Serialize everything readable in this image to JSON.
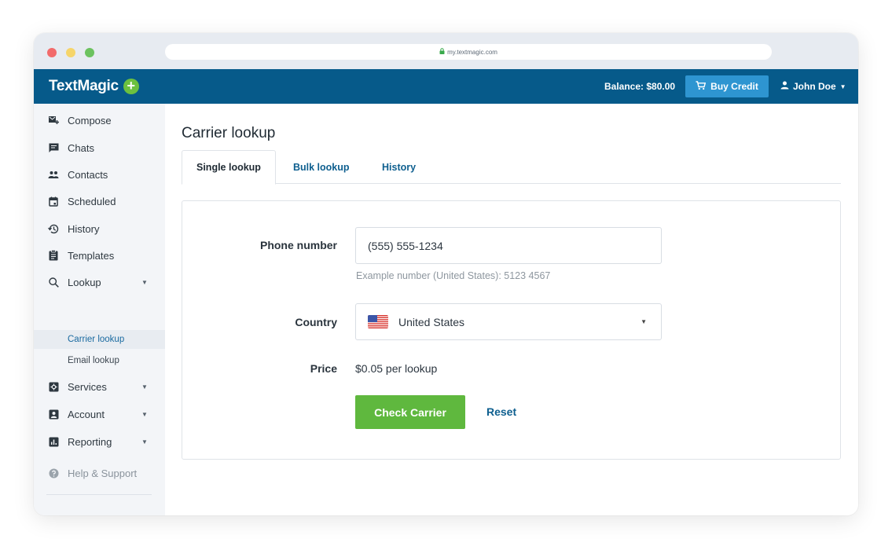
{
  "browser": {
    "url": "my.textmagic.com"
  },
  "topbar": {
    "logo": "TextMagic",
    "logo_plus": "+",
    "balance": "Balance: $80.00",
    "buy_credit": "Buy Credit",
    "user_name": "John Doe"
  },
  "sidebar": {
    "items": [
      {
        "label": "Compose",
        "icon": "compose-icon"
      },
      {
        "label": "Chats",
        "icon": "chat-icon"
      },
      {
        "label": "Contacts",
        "icon": "contacts-icon"
      },
      {
        "label": "Scheduled",
        "icon": "calendar-icon"
      },
      {
        "label": "History",
        "icon": "history-icon"
      },
      {
        "label": "Templates",
        "icon": "clipboard-icon"
      },
      {
        "label": "Lookup",
        "icon": "search-icon"
      },
      {
        "label": "Services",
        "icon": "services-icon"
      },
      {
        "label": "Account",
        "icon": "account-icon"
      },
      {
        "label": "Reporting",
        "icon": "chart-icon"
      },
      {
        "label": "Help & Support",
        "icon": "help-icon"
      }
    ],
    "lookup_sub": [
      "Carrier lookup",
      "Email lookup"
    ]
  },
  "main": {
    "title": "Carrier lookup",
    "tabs": [
      "Single lookup",
      "Bulk lookup",
      "History"
    ],
    "form": {
      "phone_label": "Phone number",
      "phone_value": "(555) 555-1234",
      "phone_hint": "Example number (United States): 5123 4567",
      "country_label": "Country",
      "country_value": "United States",
      "price_label": "Price",
      "price_value": "$0.05 per lookup",
      "check_button": "Check Carrier",
      "reset_link": "Reset"
    }
  },
  "colors": {
    "topbar": "#065a8a",
    "buy_button": "#2e95d1",
    "primary_button": "#5fb83e",
    "link": "#0e5f8f"
  }
}
